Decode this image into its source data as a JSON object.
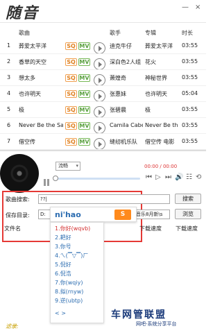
{
  "app": {
    "name": "随音"
  },
  "window": {
    "minimize": "—",
    "close": "×"
  },
  "table": {
    "headers": {
      "title": "歌曲",
      "artist": "歌手",
      "album": "专辑",
      "duration": "时长"
    },
    "rows": [
      {
        "num": "1",
        "title": "葬爱太平洋",
        "artist": "迪克牛仔",
        "album": "葬爱太平洋",
        "duration": "03:55"
      },
      {
        "num": "2",
        "title": "香草的天空",
        "artist": "深白色2人组",
        "album": "花火",
        "duration": "03:55"
      },
      {
        "num": "3",
        "title": "想太多",
        "artist": "萧煌奇",
        "album": "神秘世界",
        "duration": "03:55"
      },
      {
        "num": "4",
        "title": "也许明天",
        "artist": "张惠妹",
        "album": "也许明天",
        "duration": "05:04"
      },
      {
        "num": "5",
        "title": "极",
        "artist": "张碧晨",
        "album": "极",
        "duration": "03:55"
      },
      {
        "num": "6",
        "title": "Never Be the Sa",
        "artist": "Camila Cabe",
        "album": "Never Be the",
        "duration": "03:55"
      },
      {
        "num": "7",
        "title": "借空传",
        "artist": "缝纫机乐队",
        "album": "借空传 电影",
        "duration": "03:55"
      }
    ],
    "badges": {
      "sq": "SQ",
      "mv": "MV"
    }
  },
  "player": {
    "quality": "流畅",
    "time": "00:00 / 00:00",
    "progress": 0.02
  },
  "search": {
    "label": "歌曲搜索:",
    "value": "??|",
    "button": "搜索"
  },
  "save": {
    "label": "保存目录:",
    "value_prefix": "D:",
    "value_suffix": "音乐8月新\\s",
    "button": "浏览"
  },
  "downloads": {
    "headers": {
      "filename": "文件名",
      "speed1": "下载速度",
      "speed2": "下载速度"
    }
  },
  "ime": {
    "composition": "ni'hao",
    "logo": "S",
    "candidates": [
      "1.你好(wqvb)",
      "2.耙好",
      "3.你号",
      "4.ㄟ(▔▽▔)ㄏ",
      "5.倪好",
      "6.倪浩",
      "7.你(wqiy)",
      "8.拟(rnyw)",
      "9.逆(ubtp)"
    ],
    "more": "<  >"
  },
  "footer": {
    "tag": "滤录:"
  },
  "watermark": {
    "main": "车网管联盟",
    "sub": "网吧-系统分享平台"
  }
}
